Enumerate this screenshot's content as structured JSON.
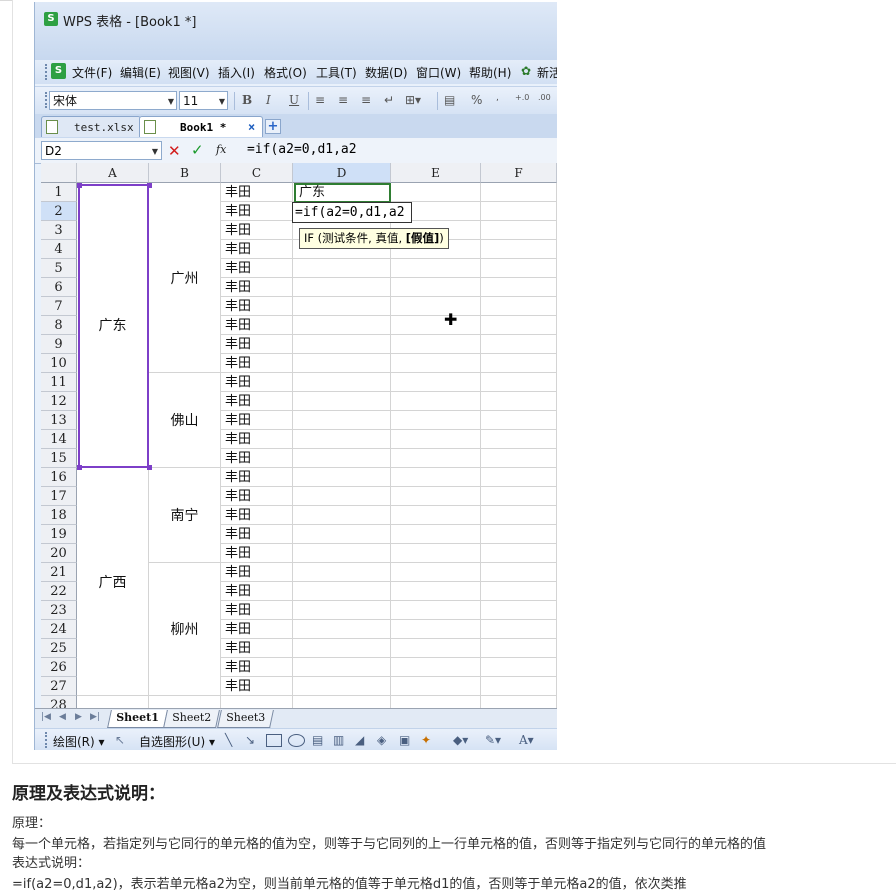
{
  "window": {
    "title": "WPS 表格 - [Book1 *]",
    "logo": "S"
  },
  "menu": {
    "logo": "S",
    "items": [
      "文件(F)",
      "编辑(E)",
      "视图(V)",
      "插入(I)",
      "格式(O)",
      "工具(T)",
      "数据(D)",
      "窗口(W)",
      "帮助(H)",
      "新活"
    ]
  },
  "toolbar": {
    "font_name": "宋体",
    "font_size": "11",
    "bold": "B",
    "italic": "I",
    "underline": "U",
    "percent": "%",
    "dec_inc": "+.0",
    "dec_dec": ".00"
  },
  "tabs": {
    "test": "test.xlsx",
    "book1": "Book1 *",
    "close": "×",
    "add": "+"
  },
  "formula": {
    "name_box": "D2",
    "cancel": "✕",
    "ok": "✓",
    "fx": "fx",
    "text": "=if(a2=0,d1,a2"
  },
  "grid": {
    "columns": [
      "A",
      "B",
      "C",
      "D",
      "E",
      "F"
    ],
    "rows": [
      "1",
      "2",
      "3",
      "4",
      "5",
      "6",
      "7",
      "8",
      "9",
      "10",
      "11",
      "12",
      "13",
      "14",
      "15",
      "16",
      "17",
      "18",
      "19",
      "20",
      "21",
      "22",
      "23",
      "24",
      "25",
      "26",
      "27",
      "28"
    ],
    "a_groups": [
      {
        "label": "广东",
        "start": 1,
        "span": 15
      },
      {
        "label": "广西",
        "start": 16,
        "span": 12
      }
    ],
    "b_groups": [
      {
        "label": "广州",
        "start": 1,
        "span": 10
      },
      {
        "label": "佛山",
        "start": 11,
        "span": 5
      },
      {
        "label": "南宁",
        "start": 16,
        "span": 5
      },
      {
        "label": "柳州",
        "start": 21,
        "span": 7
      }
    ],
    "c_value": "丰田",
    "d1": "广东",
    "d2_edit": "=if(a2=0,d1,a2",
    "tooltip": {
      "prefix": "IF (测试条件, 真值, ",
      "bold": "[假值]",
      "suffix": ")"
    }
  },
  "sheets": [
    "Sheet1",
    "Sheet2",
    "Sheet3"
  ],
  "drawbar": {
    "draw": "绘图(R)",
    "autoshape": "自选图形(U)"
  },
  "article": {
    "heading": "原理及表达式说明：",
    "lines": [
      "原理：",
      "每一个单元格，若指定列与它同行的单元格的值为空，则等于与它同列的上一行单元格的值，否则等于指定列与它同行的单元格的值",
      "表达式说明：",
      "=if(a2=0,d1,a2)，表示若单元格a2为空，则当前单元格的值等于单元格d1的值，否则等于单元格a2的值，依次类推"
    ]
  }
}
